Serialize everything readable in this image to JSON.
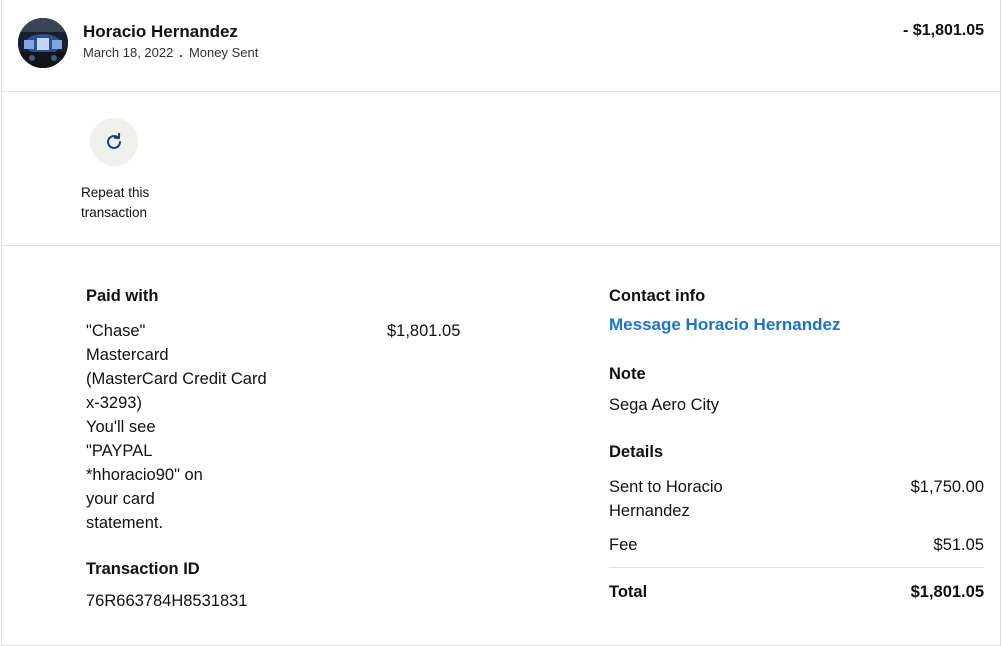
{
  "header": {
    "name": "Horacio Hernandez",
    "date": "March 18, 2022",
    "separator": ".",
    "type": "Money Sent",
    "amount": "- $1,801.05"
  },
  "actions": {
    "repeat_label": "Repeat this transaction",
    "repeat_icon": "refresh-icon"
  },
  "paid_with": {
    "heading": "Paid with",
    "lines": [
      "\"Chase\"",
      "Mastercard",
      "(MasterCard Credit Card",
      "x-3293)",
      "You'll see",
      "\"PAYPAL",
      "*hhoracio90\" on",
      "your card",
      "statement."
    ],
    "amount": "$1,801.05"
  },
  "transaction": {
    "heading": "Transaction ID",
    "id": "76R663784H8531831"
  },
  "contact": {
    "heading": "Contact info",
    "link": "Message Horacio Hernandez"
  },
  "note": {
    "heading": "Note",
    "value": "Sega Aero City"
  },
  "details": {
    "heading": "Details",
    "sent_label": "Sent to Horacio Hernandez",
    "sent_value": "$1,750.00",
    "fee_label": "Fee",
    "fee_value": "$51.05",
    "total_label": "Total",
    "total_value": "$1,801.05"
  },
  "colors": {
    "link": "#1a73d1",
    "repeat_bg": "#eef0ec",
    "repeat_icon": "#1f3a8a"
  }
}
